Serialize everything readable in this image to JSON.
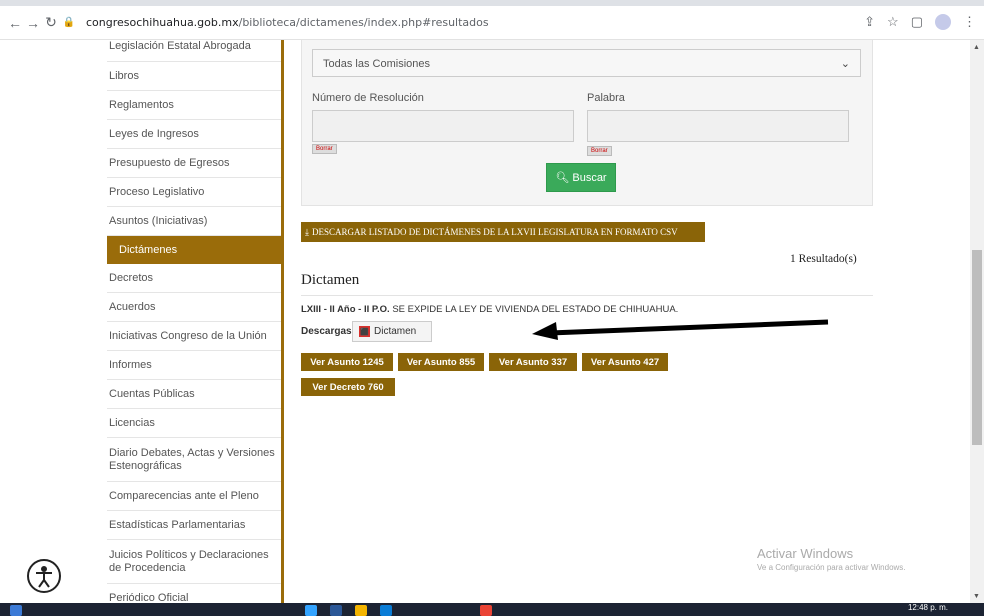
{
  "browser": {
    "url_host": "congresochihuahua.gob.mx",
    "url_path": "/biblioteca/dictamenes/index.php#resultados"
  },
  "sidebar": {
    "items": [
      {
        "label": "Legislación Estatal Abrogada"
      },
      {
        "label": "Libros"
      },
      {
        "label": "Reglamentos"
      },
      {
        "label": "Leyes de Ingresos"
      },
      {
        "label": "Presupuesto de Egresos"
      },
      {
        "label": "Proceso Legislativo"
      },
      {
        "label": "Asuntos (Iniciativas)"
      },
      {
        "label": "Dictámenes",
        "active": true
      },
      {
        "label": "Decretos"
      },
      {
        "label": "Acuerdos"
      },
      {
        "label": "Iniciativas Congreso de la Unión"
      },
      {
        "label": "Informes"
      },
      {
        "label": "Cuentas Públicas"
      },
      {
        "label": "Licencias"
      },
      {
        "label": "Diario Debates, Actas y Versiones Estenográficas"
      },
      {
        "label": "Comparecencias ante el Pleno"
      },
      {
        "label": "Estadísticas Parlamentarias"
      },
      {
        "label": "Juicios Políticos y Declaraciones de Procedencia"
      },
      {
        "label": "Periódico Oficial"
      }
    ]
  },
  "search": {
    "comisiones_value": "Todas las Comisiones",
    "resolucion_label": "Número de Resolución",
    "palabra_label": "Palabra",
    "borrar_label": "Borrar",
    "buscar_label": "Buscar"
  },
  "download_csv_label": "DESCARGAR LISTADO DE DICTÁMENES DE LA LXVII LEGISLATURA EN FORMATO CSV",
  "results_count": "1 Resultado(s)",
  "section_title": "Dictamen",
  "entry": {
    "ref": "LXIII - II Año - II P.O.",
    "text": "SE EXPIDE LA LEY DE VIVIENDA DEL ESTADO DE CHIHUAHUA.",
    "descargas_label": "Descargas:",
    "pdf_label": "Dictamen",
    "buttons": [
      "Ver Asunto 1245",
      "Ver Asunto 855",
      "Ver Asunto 337",
      "Ver Asunto 427",
      "Ver Decreto 760"
    ]
  },
  "watermark": {
    "title": "Activar Windows",
    "subtitle": "Ve a Configuración para activar Windows."
  },
  "taskbar": {
    "clock": "12:48 p. m."
  },
  "colors": {
    "accent": "#8a6408",
    "search_button": "#3aaa5a"
  }
}
